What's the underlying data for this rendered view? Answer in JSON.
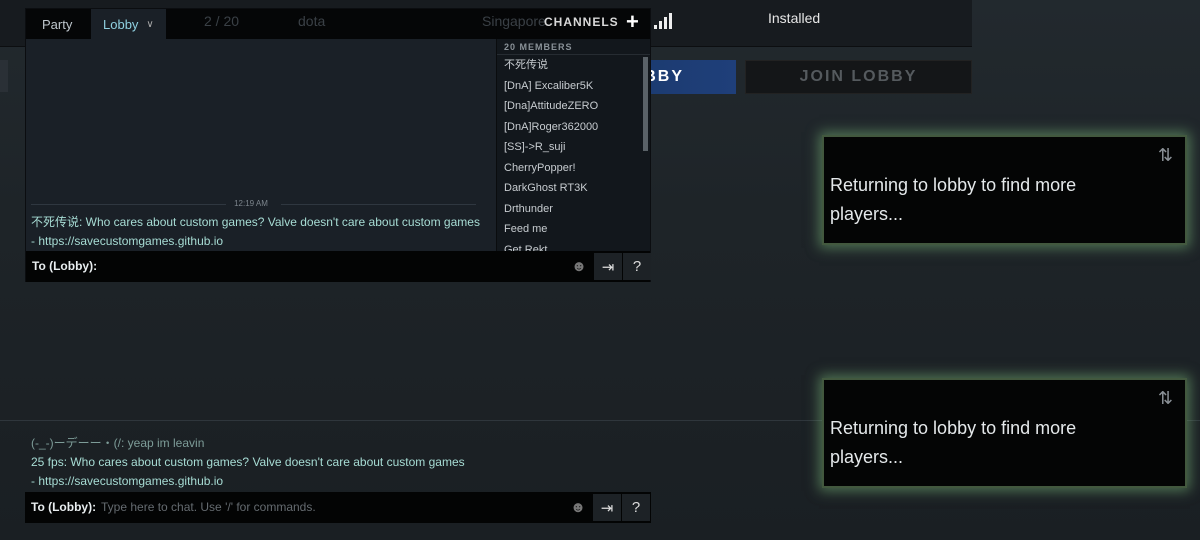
{
  "lobby_panel": {
    "status": "Installed",
    "create_button": "LOBBY",
    "join_button": "JOIN LOBBY"
  },
  "chat": {
    "tabs": [
      {
        "label": "Party"
      },
      {
        "label": "Lobby"
      }
    ],
    "ghost": {
      "slots": "2 / 20",
      "game": "dota",
      "region": "Singapore"
    },
    "channels_label": "CHANNELS",
    "members_header": "20 MEMBERS",
    "members": [
      "不死传说",
      "[DnA] Excaliber5K",
      "[Dna]AttitudeZERO",
      "[DnA]Roger362000",
      "[SS]->R_suji",
      "CherryPopper!",
      "DarkGhost RT3K",
      "Drthunder",
      "Feed me",
      "Get Rekt"
    ],
    "timestamp": "12:19 AM",
    "message": "不死传说: Who cares about custom games? Valve doesn't care about custom games - https://savecustomgames.github.io",
    "to_label": "To (Lobby):"
  },
  "bottom_chat": {
    "messages": [
      {
        "text": "(-_-)ーデーー・(/: yeap im leavin",
        "color": "#7d9c98"
      },
      {
        "text": "25 fps: Who cares about custom games? Valve doesn't care about custom games",
        "color": "#a7dcd4"
      },
      {
        "text": "- https://savecustomgames.github.io",
        "color": "#a7dcd4"
      }
    ],
    "to_label": "To (Lobby):",
    "placeholder": "Type here to chat. Use '/' for commands."
  },
  "notifications": [
    {
      "text": "Returning to lobby to find more players..."
    },
    {
      "text": "Returning to lobby to find more players..."
    }
  ],
  "icons": {
    "smile": "☻",
    "share": "⇥",
    "help": "?",
    "swap": "⇅"
  }
}
